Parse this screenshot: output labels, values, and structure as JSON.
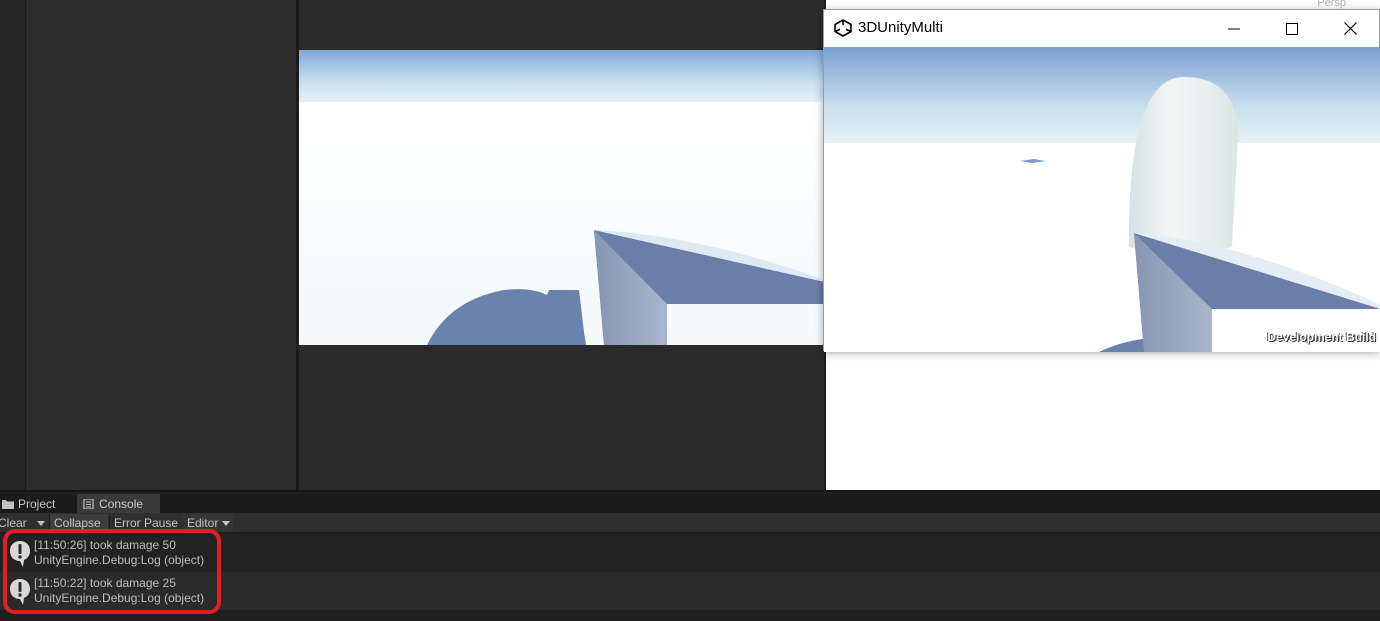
{
  "scene": {
    "label": "Persp"
  },
  "build_window": {
    "title": "3DUnityMulti",
    "watermark": "Development Build",
    "buttons": {
      "minimize": "minimize-icon",
      "maximize": "maximize-icon",
      "close": "close-icon"
    }
  },
  "tabs": [
    {
      "label": "Project",
      "icon": "folder-icon"
    },
    {
      "label": "Console",
      "icon": "console-icon"
    }
  ],
  "console_toolbar": {
    "clear": "Clear",
    "collapse": "Collapse",
    "error_pause": "Error Pause",
    "editor": "Editor"
  },
  "logs": [
    {
      "message": "[11:50:26] took damage 50",
      "trace": "UnityEngine.Debug:Log (object)",
      "icon": "info-icon"
    },
    {
      "message": "[11:50:22] took damage 25",
      "trace": "UnityEngine.Debug:Log (object)",
      "icon": "info-icon"
    }
  ],
  "colors": {
    "highlight": "#e21e26",
    "editor_bg": "#202020",
    "sky_top": "#7fa7d6"
  }
}
